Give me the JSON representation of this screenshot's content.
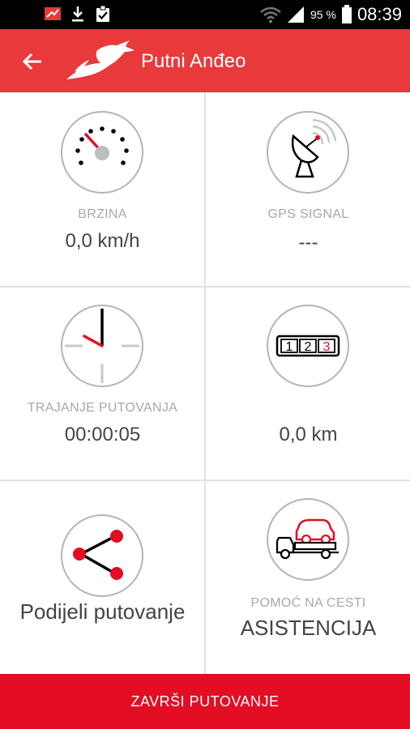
{
  "status_bar": {
    "time": "08:39",
    "battery_percent": "95 %",
    "icons": [
      "app-notification-icon",
      "download-icon",
      "clipboard-check-icon",
      "wifi-icon",
      "signal-icon",
      "battery-icon"
    ]
  },
  "app_bar": {
    "title": "Putni Anđeo",
    "back_icon": "arrow-back-icon",
    "logo_icon": "leaping-antelope-logo",
    "accent_color": "#e8393b"
  },
  "tiles": {
    "speed": {
      "label": "BRZINA",
      "value": "0,0 km/h",
      "icon": "speedometer-icon"
    },
    "gps": {
      "label": "GPS SIGNAL",
      "value": "---",
      "icon": "satellite-dish-icon"
    },
    "duration": {
      "label": "TRAJANJE PUTOVANJA",
      "value": "00:00:05",
      "icon": "clock-icon"
    },
    "distance": {
      "value": "0,0 km",
      "icon": "odometer-icon",
      "odometer_digits": [
        "1",
        "2",
        "3"
      ]
    },
    "share": {
      "label": "Podijeli putovanje",
      "icon": "share-icon"
    },
    "assistance": {
      "label": "POMOĆ NA CESTI",
      "value": "ASISTENCIJA",
      "icon": "tow-truck-icon"
    }
  },
  "footer": {
    "button_label": "ZAVRŠI PUTOVANJE",
    "color": "#e30d24"
  }
}
